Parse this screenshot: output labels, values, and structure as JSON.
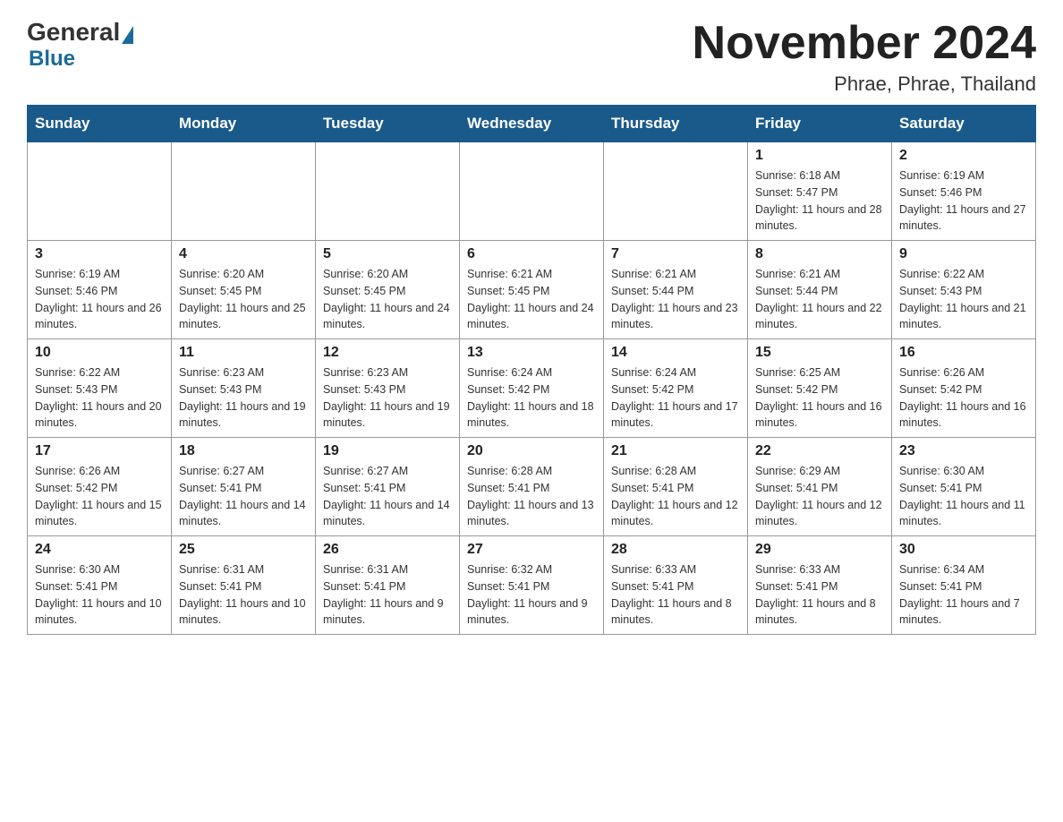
{
  "header": {
    "logo_general": "General",
    "logo_blue": "Blue",
    "month_title": "November 2024",
    "location": "Phrae, Phrae, Thailand"
  },
  "days_of_week": [
    "Sunday",
    "Monday",
    "Tuesday",
    "Wednesday",
    "Thursday",
    "Friday",
    "Saturday"
  ],
  "weeks": [
    [
      {
        "day": "",
        "sunrise": "",
        "sunset": "",
        "daylight": "",
        "empty": true
      },
      {
        "day": "",
        "sunrise": "",
        "sunset": "",
        "daylight": "",
        "empty": true
      },
      {
        "day": "",
        "sunrise": "",
        "sunset": "",
        "daylight": "",
        "empty": true
      },
      {
        "day": "",
        "sunrise": "",
        "sunset": "",
        "daylight": "",
        "empty": true
      },
      {
        "day": "",
        "sunrise": "",
        "sunset": "",
        "daylight": "",
        "empty": true
      },
      {
        "day": "1",
        "sunrise": "Sunrise: 6:18 AM",
        "sunset": "Sunset: 5:47 PM",
        "daylight": "Daylight: 11 hours and 28 minutes."
      },
      {
        "day": "2",
        "sunrise": "Sunrise: 6:19 AM",
        "sunset": "Sunset: 5:46 PM",
        "daylight": "Daylight: 11 hours and 27 minutes."
      }
    ],
    [
      {
        "day": "3",
        "sunrise": "Sunrise: 6:19 AM",
        "sunset": "Sunset: 5:46 PM",
        "daylight": "Daylight: 11 hours and 26 minutes."
      },
      {
        "day": "4",
        "sunrise": "Sunrise: 6:20 AM",
        "sunset": "Sunset: 5:45 PM",
        "daylight": "Daylight: 11 hours and 25 minutes."
      },
      {
        "day": "5",
        "sunrise": "Sunrise: 6:20 AM",
        "sunset": "Sunset: 5:45 PM",
        "daylight": "Daylight: 11 hours and 24 minutes."
      },
      {
        "day": "6",
        "sunrise": "Sunrise: 6:21 AM",
        "sunset": "Sunset: 5:45 PM",
        "daylight": "Daylight: 11 hours and 24 minutes."
      },
      {
        "day": "7",
        "sunrise": "Sunrise: 6:21 AM",
        "sunset": "Sunset: 5:44 PM",
        "daylight": "Daylight: 11 hours and 23 minutes."
      },
      {
        "day": "8",
        "sunrise": "Sunrise: 6:21 AM",
        "sunset": "Sunset: 5:44 PM",
        "daylight": "Daylight: 11 hours and 22 minutes."
      },
      {
        "day": "9",
        "sunrise": "Sunrise: 6:22 AM",
        "sunset": "Sunset: 5:43 PM",
        "daylight": "Daylight: 11 hours and 21 minutes."
      }
    ],
    [
      {
        "day": "10",
        "sunrise": "Sunrise: 6:22 AM",
        "sunset": "Sunset: 5:43 PM",
        "daylight": "Daylight: 11 hours and 20 minutes."
      },
      {
        "day": "11",
        "sunrise": "Sunrise: 6:23 AM",
        "sunset": "Sunset: 5:43 PM",
        "daylight": "Daylight: 11 hours and 19 minutes."
      },
      {
        "day": "12",
        "sunrise": "Sunrise: 6:23 AM",
        "sunset": "Sunset: 5:43 PM",
        "daylight": "Daylight: 11 hours and 19 minutes."
      },
      {
        "day": "13",
        "sunrise": "Sunrise: 6:24 AM",
        "sunset": "Sunset: 5:42 PM",
        "daylight": "Daylight: 11 hours and 18 minutes."
      },
      {
        "day": "14",
        "sunrise": "Sunrise: 6:24 AM",
        "sunset": "Sunset: 5:42 PM",
        "daylight": "Daylight: 11 hours and 17 minutes."
      },
      {
        "day": "15",
        "sunrise": "Sunrise: 6:25 AM",
        "sunset": "Sunset: 5:42 PM",
        "daylight": "Daylight: 11 hours and 16 minutes."
      },
      {
        "day": "16",
        "sunrise": "Sunrise: 6:26 AM",
        "sunset": "Sunset: 5:42 PM",
        "daylight": "Daylight: 11 hours and 16 minutes."
      }
    ],
    [
      {
        "day": "17",
        "sunrise": "Sunrise: 6:26 AM",
        "sunset": "Sunset: 5:42 PM",
        "daylight": "Daylight: 11 hours and 15 minutes."
      },
      {
        "day": "18",
        "sunrise": "Sunrise: 6:27 AM",
        "sunset": "Sunset: 5:41 PM",
        "daylight": "Daylight: 11 hours and 14 minutes."
      },
      {
        "day": "19",
        "sunrise": "Sunrise: 6:27 AM",
        "sunset": "Sunset: 5:41 PM",
        "daylight": "Daylight: 11 hours and 14 minutes."
      },
      {
        "day": "20",
        "sunrise": "Sunrise: 6:28 AM",
        "sunset": "Sunset: 5:41 PM",
        "daylight": "Daylight: 11 hours and 13 minutes."
      },
      {
        "day": "21",
        "sunrise": "Sunrise: 6:28 AM",
        "sunset": "Sunset: 5:41 PM",
        "daylight": "Daylight: 11 hours and 12 minutes."
      },
      {
        "day": "22",
        "sunrise": "Sunrise: 6:29 AM",
        "sunset": "Sunset: 5:41 PM",
        "daylight": "Daylight: 11 hours and 12 minutes."
      },
      {
        "day": "23",
        "sunrise": "Sunrise: 6:30 AM",
        "sunset": "Sunset: 5:41 PM",
        "daylight": "Daylight: 11 hours and 11 minutes."
      }
    ],
    [
      {
        "day": "24",
        "sunrise": "Sunrise: 6:30 AM",
        "sunset": "Sunset: 5:41 PM",
        "daylight": "Daylight: 11 hours and 10 minutes."
      },
      {
        "day": "25",
        "sunrise": "Sunrise: 6:31 AM",
        "sunset": "Sunset: 5:41 PM",
        "daylight": "Daylight: 11 hours and 10 minutes."
      },
      {
        "day": "26",
        "sunrise": "Sunrise: 6:31 AM",
        "sunset": "Sunset: 5:41 PM",
        "daylight": "Daylight: 11 hours and 9 minutes."
      },
      {
        "day": "27",
        "sunrise": "Sunrise: 6:32 AM",
        "sunset": "Sunset: 5:41 PM",
        "daylight": "Daylight: 11 hours and 9 minutes."
      },
      {
        "day": "28",
        "sunrise": "Sunrise: 6:33 AM",
        "sunset": "Sunset: 5:41 PM",
        "daylight": "Daylight: 11 hours and 8 minutes."
      },
      {
        "day": "29",
        "sunrise": "Sunrise: 6:33 AM",
        "sunset": "Sunset: 5:41 PM",
        "daylight": "Daylight: 11 hours and 8 minutes."
      },
      {
        "day": "30",
        "sunrise": "Sunrise: 6:34 AM",
        "sunset": "Sunset: 5:41 PM",
        "daylight": "Daylight: 11 hours and 7 minutes."
      }
    ]
  ]
}
